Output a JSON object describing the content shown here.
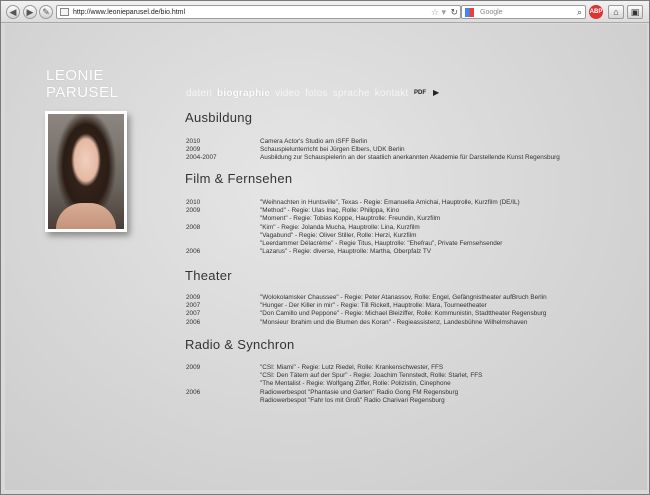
{
  "browser": {
    "url": "http://www.leonieparusel.de/bio.html",
    "search_placeholder": "Google"
  },
  "site": {
    "name_line1": "LEONIE",
    "name_line2": "PARUSEL",
    "pdf_label": "PDF"
  },
  "nav": {
    "items": [
      {
        "label": "daten"
      },
      {
        "label": "biographie"
      },
      {
        "label": "video"
      },
      {
        "label": "fotos"
      },
      {
        "label": "sprache"
      },
      {
        "label": "kontakt"
      }
    ]
  },
  "sections": [
    {
      "title": "Ausbildung",
      "rows": [
        {
          "year": "2010",
          "text": "Camera Actor's Studio am iSFF Berlin"
        },
        {
          "year": "2009",
          "text": "Schauspielunterricht bei Jürgen Elbers, UDK Berlin"
        },
        {
          "year": "2004-2007",
          "text": "Ausbildung zur Schauspielerin an der staatlich anerkannten Akademie für Darstellende Kunst Regensburg"
        }
      ]
    },
    {
      "title": "Film & Fernsehen",
      "rows": [
        {
          "year": "2010",
          "text": "\"Weihnachten in Huntsville\", Texas - Regie: Emanuella Amichai, Hauptrolle, Kurzfilm (DE/IL)"
        },
        {
          "year": "2009",
          "text": "\"Method\" - Regie: Ulas Inaç, Rolle: Philippa, Kino"
        },
        {
          "year": "",
          "text": "\"Moment\" - Regie: Tobias Koppe, Hauptrolle: Freundin, Kurzfilm"
        },
        {
          "year": "2008",
          "text": "\"Kim\" - Regie: Jolanda Mucha, Hauptrolle: Lina, Kurzfilm"
        },
        {
          "year": "",
          "text": "\"Vagabund\" - Regie: Oliver Stiller, Rolle: Herzi, Kurzfilm"
        },
        {
          "year": "",
          "text": "\"Leerdammer Délacrème\" - Regie Titus, Hauptrolle: \"Ehefrau\", Private Fernsehsender"
        },
        {
          "year": "2006",
          "text": "\"Lazarus\" - Regie: diverse, Hauptrolle: Martha, Oberpfalz TV"
        }
      ]
    },
    {
      "title": "Theater",
      "rows": [
        {
          "year": "2009",
          "text": "\"Wolokolamsker Chaussee\" - Regie: Peter Atanassov, Rolle: Engel, Gefängnistheater aufBruch Berlin"
        },
        {
          "year": "2007",
          "text": "\"Hunger - Der Killer in mir\" - Regie: Till Rickelt, Hauptrolle: Mara, Tourneetheater"
        },
        {
          "year": "2007",
          "text": "\"Don Camillo und Peppone\" - Regie: Michael Bleiziffer, Rolle: Kommunistin, Stadttheater Regensburg"
        },
        {
          "year": "2006",
          "text": "\"Monsieur Ibrahim und die Blumen des Koran\" - Regieassistenz, Landesbühne Wilhelmshaven"
        }
      ]
    },
    {
      "title": "Radio & Synchron",
      "rows": [
        {
          "year": "2009",
          "text": "\"CSI: Miami\" - Regie: Lutz Riedel, Rolle: Krankenschwester, FFS"
        },
        {
          "year": "",
          "text": "\"CSI: Den Tätern auf der Spur\" - Regie: Joachim Tennstedt, Rolle: Starlet, FFS"
        },
        {
          "year": "",
          "text": "\"The Mentalist - Regie: Wolfgang Ziffer, Rolle: Polizistin, Cinephone"
        },
        {
          "year": "2006",
          "text": "Radiowerbespot \"Phantasie und Garten\" Radio Gong FM Regensburg"
        },
        {
          "year": "",
          "text": "Radiowerbespot \"Fahr los mit Groß\" Radio Charivari Regensburg"
        }
      ]
    }
  ]
}
